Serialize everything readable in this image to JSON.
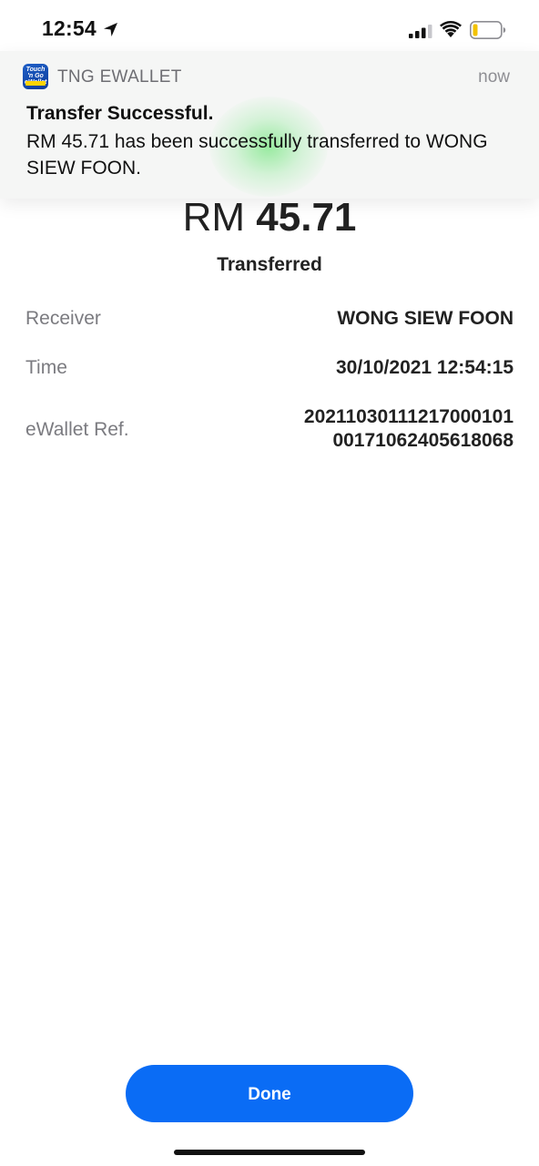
{
  "status_bar": {
    "time": "12:54",
    "icons": [
      "location-arrow-icon",
      "cellular-signal-icon",
      "wifi-icon",
      "battery-low-icon"
    ],
    "battery_color": "#f2c200"
  },
  "notification": {
    "app_icon": "touch-n-go-ewallet-icon",
    "app_icon_text": "Touch 'n Go eWallet",
    "app_name": "TNG EWALLET",
    "time": "now",
    "title": "Transfer Successful.",
    "body": "RM 45.71 has been successfully transferred to WONG SIEW FOON."
  },
  "transaction": {
    "currency": "RM",
    "amount": "45.71",
    "status": "Transferred"
  },
  "details": {
    "receiver_label": "Receiver",
    "receiver_value": "WONG SIEW FOON",
    "time_label": "Time",
    "time_value": "30/10/2021 12:54:15",
    "ref_label": "eWallet Ref.",
    "ref_value_line1": "20211030111217000101",
    "ref_value_line2": "00171062405618068"
  },
  "actions": {
    "done_label": "Done",
    "accent_color": "#0a6cf5"
  }
}
